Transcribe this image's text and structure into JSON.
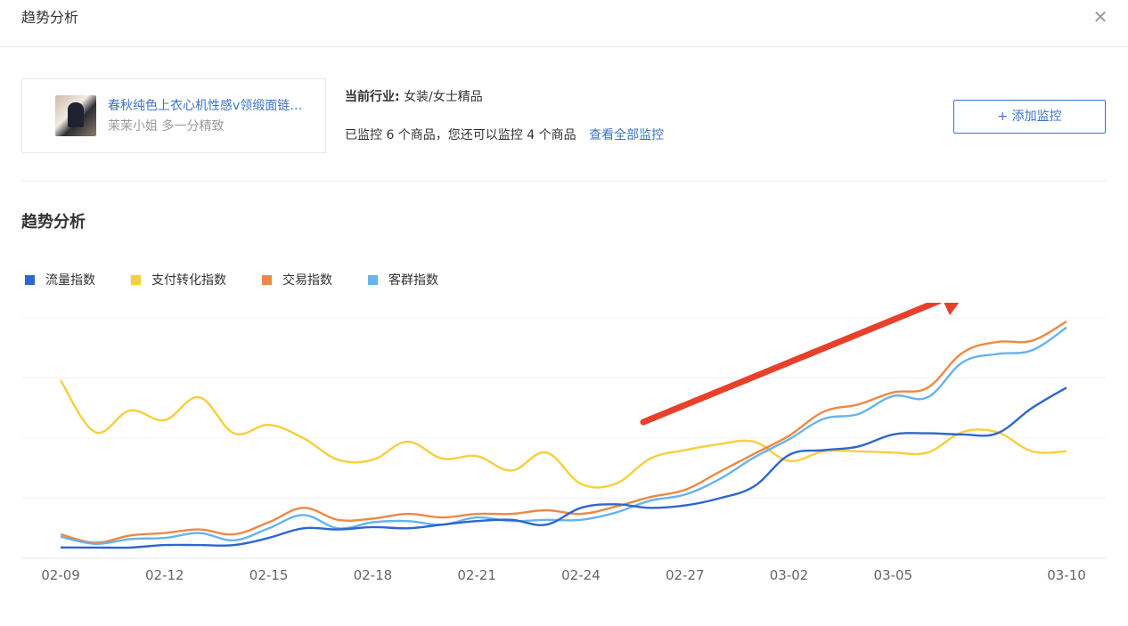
{
  "modal": {
    "title": "趋势分析",
    "close_icon": "close-icon"
  },
  "product": {
    "name": "春秋纯色上衣心机性感v领缎面链…",
    "shop": "茉茉小姐 多一分精致"
  },
  "industry": {
    "label": "当前行业:",
    "value": "女装/女士精品"
  },
  "monitor": {
    "text": "已监控 6 个商品，您还可以监控 4 个商品",
    "view_all": "查看全部监控"
  },
  "add_button": {
    "label": "+ 添加监控"
  },
  "section_title": "趋势分析",
  "colors": {
    "accent": "#3b73c6",
    "arrow": "#e8402b"
  },
  "chart_data": {
    "type": "line",
    "title": "",
    "xlabel": "",
    "ylabel": "",
    "ylim": [
      0,
      100
    ],
    "grid": true,
    "legend_position": "top-left",
    "x": [
      "02-09",
      "02-10",
      "02-11",
      "02-12",
      "02-13",
      "02-14",
      "02-15",
      "02-16",
      "02-17",
      "02-18",
      "02-19",
      "02-20",
      "02-21",
      "02-22",
      "02-23",
      "02-24",
      "02-25",
      "02-26",
      "02-27",
      "02-28",
      "03-01",
      "03-02",
      "03-03",
      "03-04",
      "03-05",
      "03-06",
      "03-07",
      "03-08",
      "03-09",
      "03-10"
    ],
    "tick_labels": [
      "02-09",
      "02-12",
      "02-15",
      "02-18",
      "02-21",
      "02-24",
      "02-27",
      "03-02",
      "03-05",
      "03-10"
    ],
    "series": [
      {
        "name": "流量指数",
        "color": "#2f66d0",
        "values": [
          4.5,
          4.5,
          4.5,
          5.5,
          5.5,
          5.5,
          8.5,
          12.5,
          12.0,
          13.0,
          12.5,
          14.0,
          15.5,
          16.0,
          14.0,
          21.0,
          22.5,
          21.0,
          22.0,
          25.0,
          30.0,
          43.0,
          45.0,
          46.5,
          51.5,
          52.0,
          51.5,
          52.0,
          62.5,
          71.0
        ]
      },
      {
        "name": "支付转化指数",
        "color": "#f6cf3c",
        "values": [
          74.0,
          52.5,
          61.5,
          57.5,
          67.0,
          52.0,
          55.5,
          50.0,
          41.0,
          41.0,
          48.5,
          41.5,
          42.5,
          36.5,
          44.0,
          31.0,
          31.0,
          41.5,
          45.0,
          47.5,
          48.5,
          40.5,
          44.5,
          44.5,
          44.0,
          44.0,
          52.5,
          52.5,
          44.5,
          44.5
        ]
      },
      {
        "name": "交易指数",
        "color": "#ee8844",
        "values": [
          10.0,
          6.5,
          9.5,
          10.5,
          12.0,
          10.0,
          15.0,
          21.0,
          16.0,
          16.5,
          18.5,
          17.0,
          18.5,
          18.5,
          20.0,
          18.5,
          21.5,
          25.5,
          28.5,
          36.0,
          43.5,
          51.0,
          61.0,
          64.0,
          69.0,
          71.0,
          85.5,
          90.0,
          90.5,
          98.5
        ]
      },
      {
        "name": "客群指数",
        "color": "#66b3ef",
        "values": [
          9.0,
          6.0,
          8.0,
          8.5,
          10.5,
          7.5,
          12.5,
          18.0,
          12.5,
          15.0,
          15.5,
          14.0,
          17.0,
          15.5,
          16.0,
          16.0,
          19.0,
          24.0,
          26.5,
          33.0,
          42.0,
          49.5,
          58.0,
          60.0,
          67.5,
          67.0,
          81.5,
          85.0,
          86.5,
          96.0
        ]
      }
    ]
  }
}
